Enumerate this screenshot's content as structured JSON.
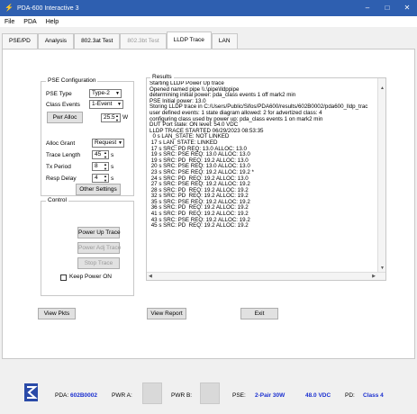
{
  "window": {
    "title": "PDA-600 Interactive 3",
    "app_icon": "wand-icon",
    "controls": [
      "–",
      "□",
      "✕"
    ]
  },
  "menu": [
    "File",
    "PDA",
    "Help"
  ],
  "tabs": [
    "PSE/PD",
    "Analysis",
    "802.3at Test",
    "802.3bt Test",
    "LLDP Trace",
    "LAN"
  ],
  "active_tab": "LLDP Trace",
  "pse_config": {
    "title": "PSE Configuration",
    "pse_type_label": "PSE Type",
    "pse_type_value": "Type-2",
    "class_events_label": "Class Events",
    "class_events_value": "1-Event",
    "pwr_alloc_button": "Pwr Alloc",
    "pwr_alloc_value": "25.5",
    "pwr_alloc_unit": "W",
    "alloc_grant_label": "Alloc Grant",
    "alloc_grant_value": "Request",
    "trace_length_label": "Trace Length",
    "trace_length_value": "45",
    "trace_length_unit": "s",
    "tx_period_label": "Tx Period",
    "tx_period_value": "8",
    "tx_period_unit": "s",
    "resp_delay_label": "Resp Delay",
    "resp_delay_value": "4",
    "resp_delay_unit": "s",
    "other_settings_button": "Other Settings"
  },
  "control": {
    "title": "Control",
    "power_up_trace": "Power Up Trace",
    "power_adj_trace": "Power Adj Trace",
    "stop_trace": "Stop Trace",
    "keep_power_on": "Keep Power ON"
  },
  "results": {
    "title": "Results",
    "lines": [
      "Starting LLDP Power Up trace",
      "Opened named pipe \\\\.\\pipe\\lldppipe",
      "determining initial power: pda_class events 1 off mark2 min",
      "PSE Initial power: 13.0",
      "Storing LLDP trace in C:/Users/Public/Sifos/PDA600/results/602B0002/pda600_lldp_trac",
      "user defined events: 1 state diagram allowed: 2 for advertized class: 4",
      "configuring class used by power up: pda_class events 1 on mark2 min",
      "DUT Port state: ON level: 54.0 VDC",
      "LLDP TRACE STARTED 06/29/2023 08:53:35",
      "  0 s LAN_STATE: NOT LINKED",
      " 17 s LAN_STATE: LINKED",
      " 17 s SRC: PD REQ: 13.0 ALLOC: 13.0",
      " 19 s SRC: PSE REQ: 13.0 ALLOC: 13.0",
      " 19 s SRC: PD  REQ: 19.2 ALLOC: 13.0",
      " 20 s SRC: PSE REQ: 13.0 ALLOC: 13.0",
      " 23 s SRC: PSE REQ: 19.2 ALLOC: 19.2 *",
      " 24 s SRC: PD  REQ: 19.2 ALLOC: 13.0",
      " 27 s SRC: PSE REQ: 19.2 ALLOC: 19.2",
      " 28 s SRC: PD  REQ: 19.2 ALLOC: 19.2",
      " 32 s SRC: PD  REQ: 19.2 ALLOC: 19.2",
      " 35 s SRC: PSE REQ: 19.2 ALLOC: 19.2",
      " 36 s SRC: PD  REQ: 19.2 ALLOC: 19.2",
      " 41 s SRC: PD  REQ: 19.2 ALLOC: 19.2",
      " 43 s SRC: PSE REQ: 19.2 ALLOC: 19.2",
      " 45 s SRC: PD  REQ: 19.2 ALLOC: 19.2"
    ]
  },
  "bottom_buttons": {
    "view_pkts": "View Pkts",
    "view_report": "View Report",
    "exit": "Exit"
  },
  "status": {
    "logo": "sifos-logo-icon",
    "pda_label": "PDA:",
    "pda_value": "602B0002",
    "pwr_a_label": "PWR A:",
    "pwr_b_label": "PWR B:",
    "pse_label": "PSE:",
    "pse_value": "2-Pair 30W",
    "voltage_value": "48.0 VDC",
    "pd_label": "PD:",
    "pd_value": "Class 4"
  }
}
